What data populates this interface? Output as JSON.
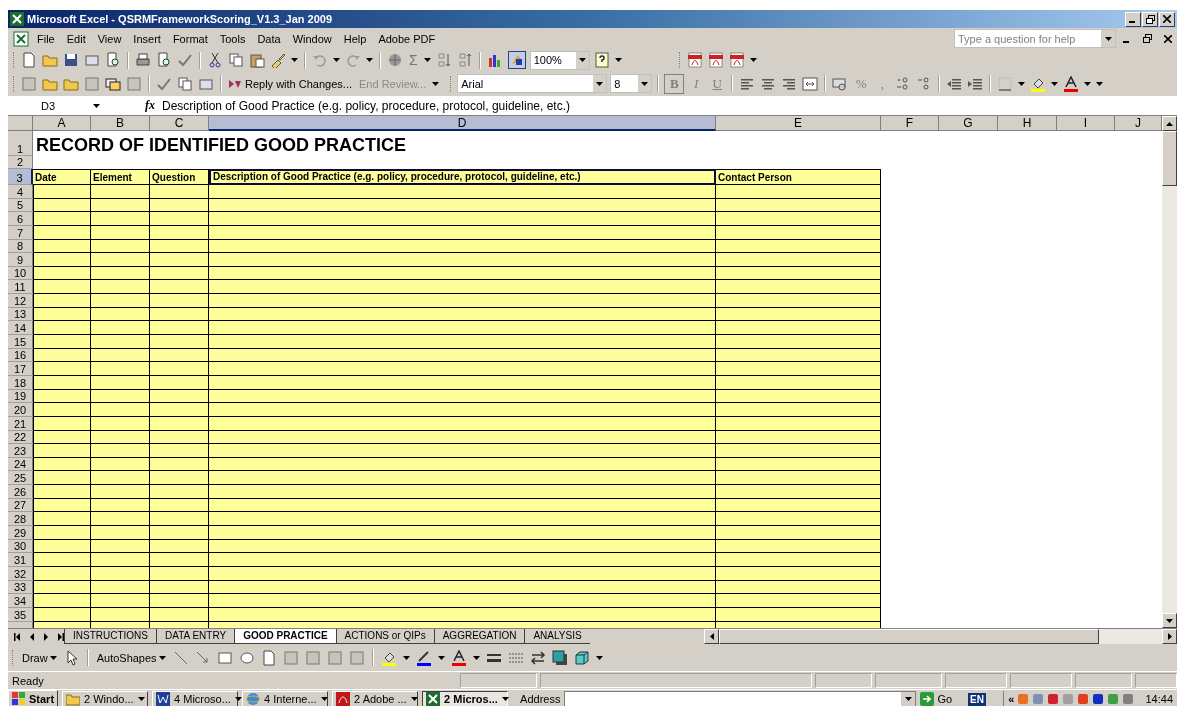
{
  "window": {
    "title": "Microsoft Excel - QSRMFrameworkScoring_V1.3_Jan 2009"
  },
  "menu": [
    "File",
    "Edit",
    "View",
    "Insert",
    "Format",
    "Tools",
    "Data",
    "Window",
    "Help",
    "Adobe PDF"
  ],
  "help_box": {
    "placeholder": "Type a question for help"
  },
  "standard_toolbar": {
    "sigma": "Σ",
    "zoom": "100%"
  },
  "reviewing_toolbar": {
    "reply": "Reply with Changes...",
    "end_review": "End Review..."
  },
  "formatting_toolbar": {
    "font": "Arial",
    "size": "8",
    "bold": "B",
    "italic": "I",
    "underline": "U",
    "percent": "%",
    "comma": ","
  },
  "formula_bar": {
    "name_box": "D3",
    "fx": "fx",
    "content": "Description of Good Practice (e.g. policy, procedure, protocol, guideline, etc.)"
  },
  "sheet": {
    "columns": [
      {
        "label": "A",
        "selected": false
      },
      {
        "label": "B",
        "selected": false
      },
      {
        "label": "C",
        "selected": false
      },
      {
        "label": "D",
        "selected": true
      },
      {
        "label": "E",
        "selected": false
      },
      {
        "label": "F",
        "selected": false
      },
      {
        "label": "G",
        "selected": false
      },
      {
        "label": "H",
        "selected": false
      },
      {
        "label": "I",
        "selected": false
      },
      {
        "label": "J",
        "selected": false
      }
    ],
    "rows": [
      {
        "label": "1",
        "selected": false
      },
      {
        "label": "2",
        "selected": false
      },
      {
        "label": "3",
        "selected": true
      },
      {
        "label": "4",
        "selected": false
      },
      {
        "label": "5",
        "selected": false
      },
      {
        "label": "6",
        "selected": false
      },
      {
        "label": "7",
        "selected": false
      },
      {
        "label": "8",
        "selected": false
      },
      {
        "label": "9",
        "selected": false
      },
      {
        "label": "10",
        "selected": false
      },
      {
        "label": "11",
        "selected": false
      },
      {
        "label": "12",
        "selected": false
      },
      {
        "label": "13",
        "selected": false
      },
      {
        "label": "14",
        "selected": false
      },
      {
        "label": "15",
        "selected": false
      },
      {
        "label": "16",
        "selected": false
      },
      {
        "label": "17",
        "selected": false
      },
      {
        "label": "18",
        "selected": false
      },
      {
        "label": "19",
        "selected": false
      },
      {
        "label": "20",
        "selected": false
      },
      {
        "label": "21",
        "selected": false
      },
      {
        "label": "22",
        "selected": false
      },
      {
        "label": "23",
        "selected": false
      },
      {
        "label": "24",
        "selected": false
      },
      {
        "label": "25",
        "selected": false
      },
      {
        "label": "26",
        "selected": false
      },
      {
        "label": "27",
        "selected": false
      },
      {
        "label": "28",
        "selected": false
      },
      {
        "label": "29",
        "selected": false
      },
      {
        "label": "30",
        "selected": false
      },
      {
        "label": "31",
        "selected": false
      },
      {
        "label": "32",
        "selected": false
      },
      {
        "label": "33",
        "selected": false
      },
      {
        "label": "34",
        "selected": false
      },
      {
        "label": "35",
        "selected": false
      }
    ],
    "title": "RECORD OF IDENTIFIED GOOD PRACTICE",
    "headers": [
      {
        "text": "Date",
        "selected": false
      },
      {
        "text": "Element",
        "selected": false
      },
      {
        "text": "Question",
        "selected": false
      },
      {
        "text": "Description of Good Practice (e.g. policy, procedure, protocol, guideline, etc.)",
        "selected": true
      },
      {
        "text": "Contact Person",
        "selected": false
      }
    ]
  },
  "sheet_tabs": [
    {
      "label": "INSTRUCTIONS",
      "selected": false
    },
    {
      "label": "DATA ENTRY",
      "selected": false
    },
    {
      "label": "GOOD PRACTICE",
      "selected": true
    },
    {
      "label": "ACTIONS or QIPs",
      "selected": false
    },
    {
      "label": "AGGREGATION",
      "selected": false
    },
    {
      "label": "ANALYSIS",
      "selected": false
    }
  ],
  "drawing_toolbar": {
    "draw": "Draw",
    "autoshapes": "AutoShapes"
  },
  "status_bar": {
    "text": "Ready"
  },
  "taskbar": {
    "start": "Start",
    "buttons": [
      {
        "label": "2 Windo...",
        "kind": "folder",
        "selected": false
      },
      {
        "label": "4 Microso...",
        "kind": "word",
        "selected": false
      },
      {
        "label": "4 Interne...",
        "kind": "browser",
        "selected": false
      },
      {
        "label": "2 Adobe ...",
        "kind": "pdf",
        "selected": false
      },
      {
        "label": "2 Micros...",
        "kind": "excel",
        "selected": true
      }
    ],
    "address_label": "Address",
    "go": "Go",
    "language": "EN",
    "tray_expand": "«",
    "clock": "14:44"
  }
}
